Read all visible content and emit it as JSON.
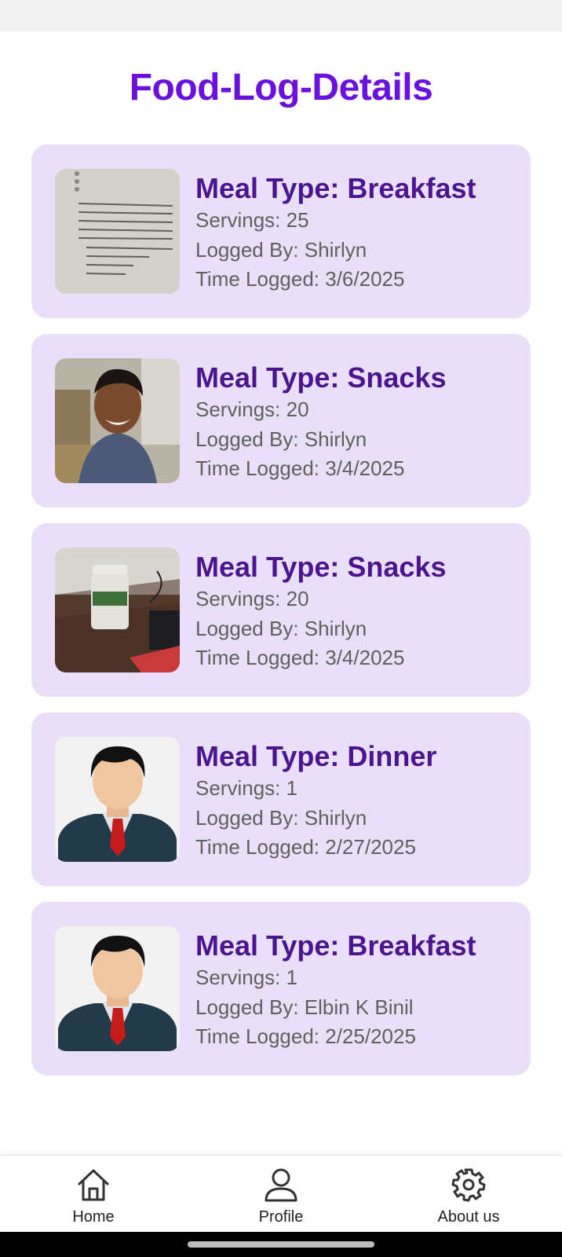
{
  "page": {
    "title": "Food-Log-Details"
  },
  "entries": [
    {
      "meal_type": "Meal Type: Breakfast",
      "servings": "Servings: 25",
      "logged_by": "Logged By: Shirlyn",
      "time_logged": "Time Logged: 3/6/2025",
      "thumbnail": "document-photo"
    },
    {
      "meal_type": "Meal Type: Snacks",
      "servings": "Servings: 20",
      "logged_by": "Logged By: Shirlyn",
      "time_logged": "Time Logged: 3/4/2025",
      "thumbnail": "person-selfie-photo"
    },
    {
      "meal_type": "Meal Type: Snacks",
      "servings": "Servings: 20",
      "logged_by": "Logged By: Shirlyn",
      "time_logged": "Time Logged: 3/4/2025",
      "thumbnail": "bottle-on-desk-photo"
    },
    {
      "meal_type": "Meal Type: Dinner",
      "servings": "Servings: 1",
      "logged_by": "Logged By: Shirlyn",
      "time_logged": "Time Logged: 2/27/2025",
      "thumbnail": "default-avatar-illustration"
    },
    {
      "meal_type": "Meal Type: Breakfast",
      "servings": "Servings: 1",
      "logged_by": "Logged By: Elbin K Binil",
      "time_logged": "Time Logged: 2/25/2025",
      "thumbnail": "default-avatar-illustration"
    }
  ],
  "nav": {
    "items": [
      {
        "label": "Home",
        "icon": "home-icon"
      },
      {
        "label": "Profile",
        "icon": "profile-icon"
      },
      {
        "label": "About us",
        "icon": "gear-icon"
      }
    ]
  },
  "colors": {
    "title": "#6a11e0",
    "card_bg": "#eadff8",
    "meal_type": "#4a1690",
    "detail_text": "#5f5f5f"
  }
}
